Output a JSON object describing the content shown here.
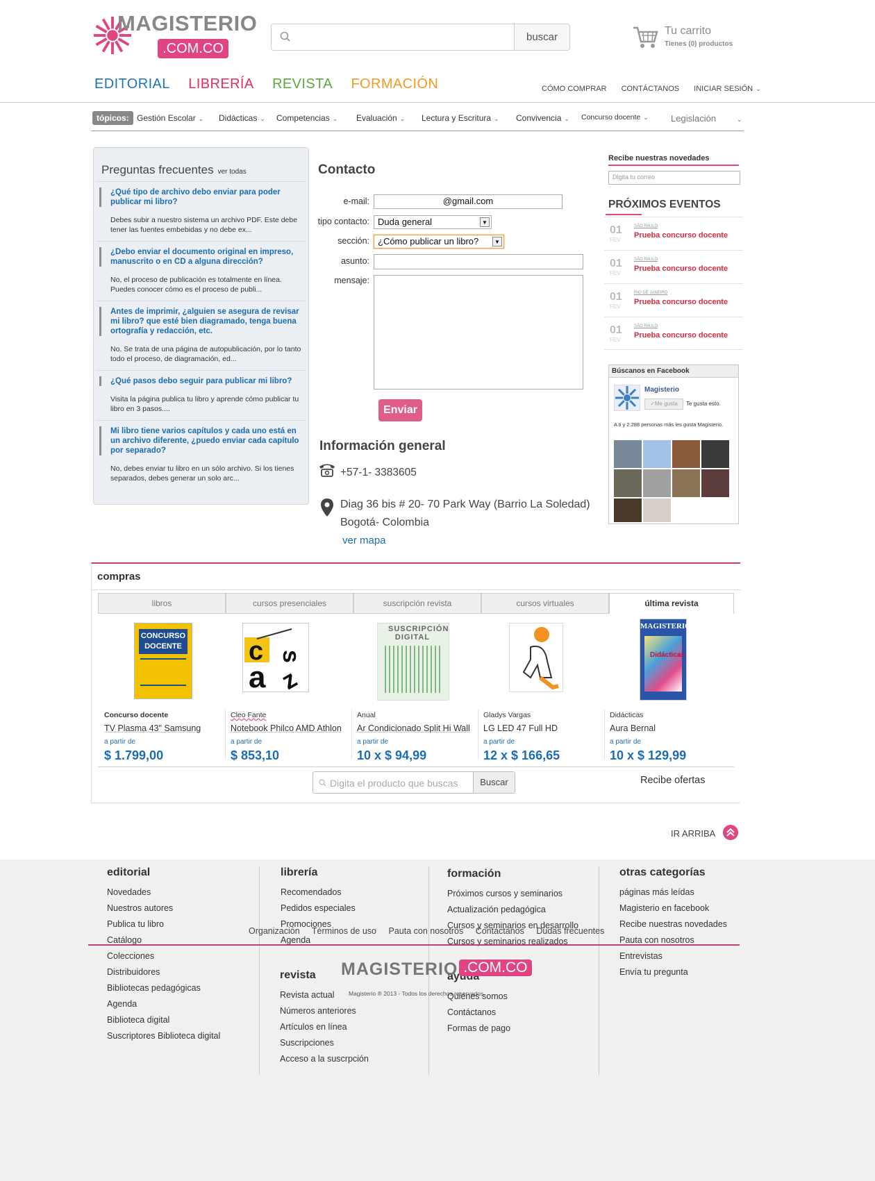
{
  "header": {
    "logo_word": "MAGISTERIO",
    "logo_domain": ".COM.CO",
    "search_button": "buscar",
    "cart_title": "Tu carrito",
    "cart_sub": "Tienes (0) productos"
  },
  "main_nav": [
    {
      "label": "EDITORIAL",
      "color": "#1e74bb"
    },
    {
      "label": "LIBRERÍA",
      "color": "#e3305e"
    },
    {
      "label": "REVISTA",
      "color": "#5aa83b"
    },
    {
      "label": "FORMACIÓN",
      "color": "#f39a24"
    }
  ],
  "top_right": [
    "CÓMO COMPRAR",
    "CONTÁCTANOS",
    "INICIAR SESIÓN"
  ],
  "topics": {
    "label": "tópicos:",
    "items": [
      "Gestión Escolar",
      "Didácticas",
      "Competencias",
      "Evaluación",
      "Lectura y Escritura",
      "Convivencia",
      "Concurso docente",
      "Legislación"
    ]
  },
  "faq": {
    "title": "Preguntas frecuentes",
    "see_all": "ver todas",
    "items": [
      {
        "q": "¿Qué tipo de archivo debo enviar para poder publicar mi libro?",
        "a": "Debes subir a nuestro sistema un archivo PDF. Este debe tener las fuentes embebidas y no debe ex..."
      },
      {
        "q": "¿Debo enviar el documento original en impreso, manuscrito o en CD a alguna dirección?",
        "a": "No, el proceso de publicación es totalmente en línea. Puedes conocer cómo es el proceso de publi..."
      },
      {
        "q": "Antes de imprimir, ¿alguien se asegura de revisar mi libro? que esté bien diagramado, tenga buena ortografía y redacción, etc.",
        "a": "No. Se trata de una página de autopublicación, por lo tanto todo el proceso, de diagramación, ed..."
      },
      {
        "q": "¿Qué pasos debo seguir para publicar mi libro?",
        "a": "Visita la página publica tu libro y aprende cómo publicar tu libro en 3 pasos...."
      },
      {
        "q": "Mi libro tiene varios capítulos y cada uno está en un archivo diferente, ¿puedo enviar cada capítulo por separado?",
        "a": "No, debes enviar tu libro en un sólo archivo. Si los tienes separados, debes generar un solo arc..."
      }
    ]
  },
  "contact": {
    "title": "Contacto",
    "email_label": "e-mail:",
    "email_value": "@gmail.com",
    "tipo_label": "tipo contacto:",
    "tipo_value": "Duda general",
    "seccion_label": "sección:",
    "seccion_value": "¿Cómo publicar un libro?",
    "asunto_label": "asunto:",
    "mensaje_label": "mensaje:",
    "submit": "Enviar"
  },
  "info": {
    "title": "Información general",
    "phone": "+57-1- 3383605",
    "address1": "Diag 36 bis # 20- 70 Park Way (Barrio La Soledad)",
    "address2": "Bogotá- Colombia",
    "map_link": "ver mapa"
  },
  "newsletter": {
    "title": "Recibe nuestras novedades",
    "placeholder": "Digita tu correo"
  },
  "events": {
    "title": "PRÓXIMOS EVENTOS",
    "items": [
      {
        "day": "01",
        "month": "FEV",
        "city": "SÃO PAULO",
        "name": "Prueba concurso docente"
      },
      {
        "day": "01",
        "month": "FEV",
        "city": "SÃO PAULO",
        "name": "Prueba concurso docente"
      },
      {
        "day": "01",
        "month": "FEV",
        "city": "RIO DE JANEIRO",
        "name": "Prueba concurso docente"
      },
      {
        "day": "01",
        "month": "FEV",
        "city": "SÃO PAULO",
        "name": "Prueba concurso docente"
      }
    ]
  },
  "facebook": {
    "title": "Búscanos en Facebook",
    "page": "Magisterio",
    "like": "Me gusta",
    "like_text": "Te gusta esto.",
    "fans": "A ti y 2.288 personas más les gusta Magisterio."
  },
  "compras": {
    "title": "compras",
    "tabs": [
      "libros",
      "cursos presenciales",
      "suscripción revista",
      "cursos virtuales",
      "última revista"
    ],
    "products": [
      {
        "type": "Concurso docente",
        "name": "TV Plasma 43\" Samsung",
        "from": "a partir de",
        "price": "$ 1.799,00"
      },
      {
        "type": "Cleo Fante",
        "name": "Notebook Philco AMD Athlon",
        "from": "a partir de",
        "price": "$ 853,10"
      },
      {
        "type": "Anual",
        "name": "Ar Condicionado Split Hi Wall",
        "from": "a partir de",
        "price": "10 x $ 94,99"
      },
      {
        "type": "Gladys Vargas",
        "name": "LG LED 47 Full HD",
        "from": "a partir de",
        "price": "12 x $ 166,65"
      },
      {
        "type": "Didácticas",
        "name": "Aura Bernal",
        "from": "a partir de",
        "price": "10 x $ 129,99"
      }
    ],
    "product_images": [
      "CONCURSO DOCENTE",
      "SUSCRIPCIÓN DIGITAL",
      "MAGISTERIO",
      "Didácticas"
    ],
    "search_placeholder": "Digita el producto que buscas",
    "search_button": "Buscar",
    "offers": "Recibe ofertas"
  },
  "ir_arriba": "IR ARRIBA",
  "footer": {
    "columns": [
      {
        "title": "editorial",
        "links": [
          "Novedades",
          "Nuestros autores",
          "Publica tu libro",
          "Catálogo",
          "Colecciones",
          "Distribuidores",
          "Bibliotecas pedagógicas",
          "Agenda",
          "Biblioteca digital",
          "Suscriptores Biblioteca digital"
        ]
      },
      {
        "title": "librería",
        "links": [
          "Recomendados",
          "Pedidos especiales",
          "Promociones",
          "Agenda"
        ]
      },
      {
        "title": "revista",
        "links": [
          "Revista actual",
          "Números anteriores",
          "Artículos en línea",
          "Suscripciones",
          "Acceso a la suscrpción"
        ]
      },
      {
        "title": "formación",
        "links": [
          "Próximos cursos y seminarios",
          "Actualización pedagógica",
          "Cursos y seminarios en desarrollo",
          "Cursos y seminarios realizados"
        ]
      },
      {
        "title": "ayuda",
        "links": [
          "Quiénes somos",
          "Contáctanos",
          "Formas de pago"
        ]
      },
      {
        "title": "otras categorías",
        "links": [
          "páginas más leídas",
          "Magisterio en facebook",
          "Recibe nuestras novedades",
          "Pauta con nosotros",
          "Entrevistas",
          "Envía tu pregunta"
        ]
      }
    ],
    "bottom_links": [
      "Organización",
      "Términos de uso",
      "Pauta con nosotros",
      "Contáctanos",
      "Dudas frecuentes"
    ],
    "copyright": "Magisterio ® 2013 - Todos los derechos reservados."
  },
  "colors": {
    "brand_pink": "#e04482",
    "link_blue": "#1c6cb3",
    "event_red": "#d9293f"
  }
}
